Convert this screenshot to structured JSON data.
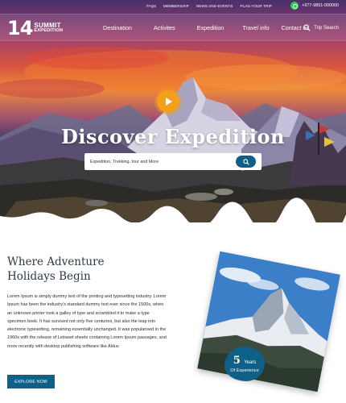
{
  "topbar": {
    "links": [
      "FAQs",
      "MEMBERSHIP",
      "NEWS AND EVENTS",
      "PLAN YOUR TRIP"
    ],
    "phone": "+977-9851-000000"
  },
  "logo": {
    "number": "14",
    "line1": "SUMMIT",
    "line2": "EXPEDITION"
  },
  "nav": {
    "items": [
      "Destination",
      "Activites",
      "Expedition",
      "Travel info",
      "Contact us"
    ],
    "search_label": "Trip Search"
  },
  "hero": {
    "title": "Discover  Expedition",
    "search_placeholder": "Expedition, Trekking, tour and More"
  },
  "about": {
    "title_line1": "Where Adventure",
    "title_line2": "Holidays Begin",
    "body": "Lorem Ipsum is simply dummy text of the printing and typesetting industry. Lorem Ipsum has been the industry's standard dummy text ever since the 1500s, when an unknown printer took a galley of type and scrambled it to make a type specimen book. It has survived not only five centuries, but also the leap into electronic typesetting, remaining essentially unchanged. It was popularised in the 1960s with the release of Letraset sheets containing Lorem Ipsum passages, and more recently with desktop publishing software like Aldus",
    "button": "EXPLORE NOW"
  },
  "badge": {
    "number": "5",
    "years": "Years",
    "label": "Of Experience"
  },
  "icons": {
    "phone": "whatsapp-icon",
    "search": "search-icon",
    "play": "play-icon"
  },
  "colors": {
    "accent": "#0f5f86",
    "play": "#f3a01c",
    "heading": "#2d3a46"
  }
}
